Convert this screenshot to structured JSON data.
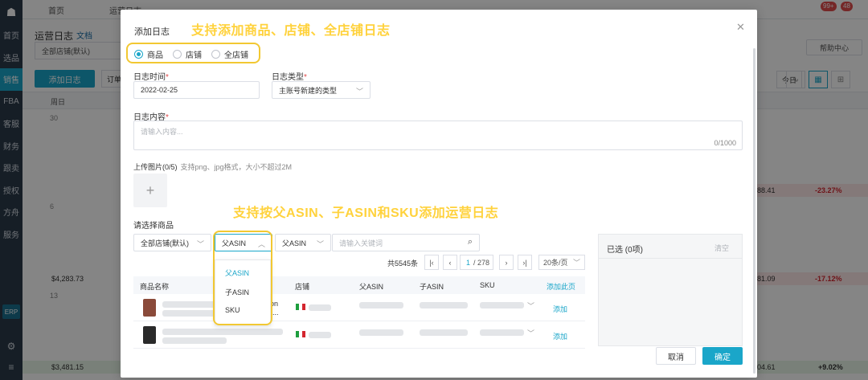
{
  "nav": {
    "items": [
      "首页",
      "选品",
      "销售",
      "FBA",
      "客服",
      "财务",
      "跟卖",
      "授权",
      "方舟",
      "服务"
    ],
    "erp_label": "ERP"
  },
  "topbar": {
    "tabs": [
      "首页",
      "运营日志"
    ],
    "badge_left": "99+",
    "badge_right": "48"
  },
  "page": {
    "title": "运营日志",
    "doc_link": "文档",
    "store_select": "全部店铺(默认)",
    "add_log_label": "添加日志",
    "order_label": "订单",
    "help_label": "帮助中心",
    "today_label": "今日",
    "cal_header": "周日",
    "days": [
      "30",
      "6",
      "13"
    ],
    "left_values": [
      "$4,283.73",
      "$3,481.15"
    ],
    "right_values": [
      "88.41",
      "81.09",
      "04.61"
    ],
    "right_pcts": [
      "-23.27%",
      "-17.12%",
      "+9.02%"
    ]
  },
  "modal": {
    "title": "添加日志",
    "radio_options": [
      "商品",
      "店铺",
      "全店铺"
    ],
    "radio_selected": "商品",
    "date_label": "日志时间",
    "date_value": "2022-02-25",
    "type_label": "日志类型",
    "type_value": "主账号新建的类型",
    "content_label": "日志内容",
    "content_placeholder": "请输入内容...",
    "content_count": "0/1000",
    "upload_label": "上传图片(0/5)",
    "upload_hint": "支持png、jpg格式，大小不超过2M",
    "select_goods_label": "请选择商品",
    "filter_store": "全部店铺(默认)",
    "filter_asin_type": "父ASIN",
    "filter_asin_type2": "父ASIN",
    "search_placeholder": "请输入关键词",
    "dropdown_options": [
      "父ASIN",
      "子ASIN",
      "SKU"
    ],
    "pagination": {
      "total": "共5545条",
      "current_page": "1",
      "total_pages": "/ 278",
      "page_size": "20条/页"
    },
    "table_headers": [
      "商品名称",
      "店铺",
      "父ASIN",
      "子ASIN",
      "SKU",
      "添加此页"
    ],
    "row_action": "添加",
    "row1_partial": "on",
    "row1_partial2": "...",
    "selected_title": "已选 (0项)",
    "clear_label": "清空",
    "cancel_label": "取消",
    "ok_label": "确定"
  },
  "annotations": {
    "top": "支持添加商品、店铺、全店铺日志",
    "middle": "支持按父ASIN、子ASIN和SKU添加运营日志"
  },
  "colors": {
    "accent": "#1aa6c9",
    "annotation": "#ffd23c",
    "negative": "#d4262f"
  }
}
